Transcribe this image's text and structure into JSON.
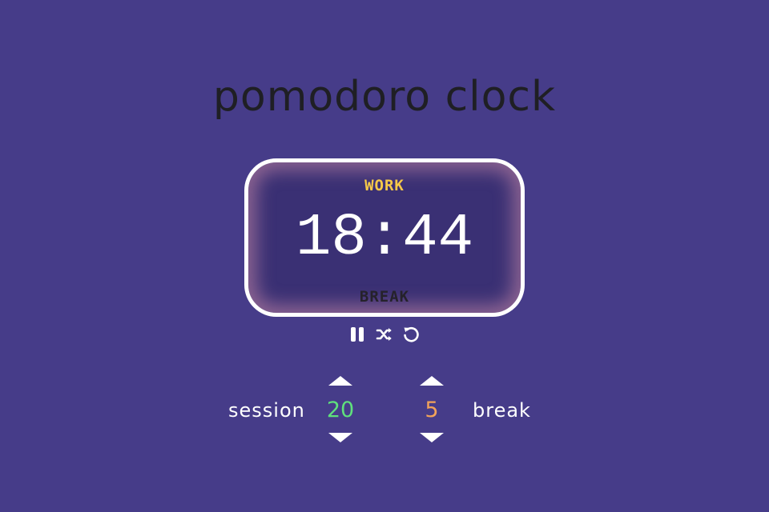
{
  "app": {
    "title": "pomodoro clock"
  },
  "display": {
    "work_label": "WORK",
    "break_label": "BREAK",
    "time": "18:44",
    "active_mode": "work"
  },
  "controls": {
    "icons": [
      "pause-icon",
      "shuffle-icon",
      "reset-icon"
    ]
  },
  "settings": {
    "session": {
      "label": "session",
      "value": "20"
    },
    "break": {
      "label": "break",
      "value": "5"
    }
  },
  "colors": {
    "background": "#463c89",
    "display_background": "#3a3074",
    "work_active": "#f7c948",
    "break_inactive": "#25222b",
    "session_value": "#5fe07c",
    "break_value": "#f2a35a",
    "title": "#1f1f24"
  }
}
